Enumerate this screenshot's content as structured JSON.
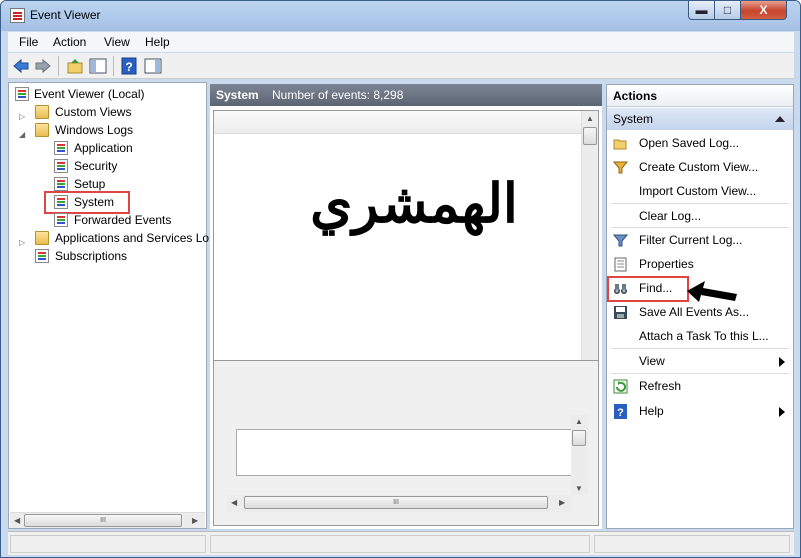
{
  "window": {
    "title": "Event Viewer",
    "icon": "event-viewer-icon"
  },
  "caption_buttons": {
    "minimize": "▬",
    "maximize": "□",
    "close": "X"
  },
  "menubar": [
    "File",
    "Action",
    "View",
    "Help"
  ],
  "toolbar": [
    "back-arrow-icon",
    "forward-arrow-icon",
    "up-folder-icon",
    "show-hide-tree-icon",
    "help-icon",
    "show-hide-action-pane-icon"
  ],
  "tree": {
    "root": "Event Viewer (Local)",
    "items": [
      {
        "label": "Custom Views",
        "icon": "folder-icon"
      },
      {
        "label": "Windows Logs",
        "icon": "folder-icon"
      },
      {
        "label": "Application",
        "icon": "log-icon"
      },
      {
        "label": "Security",
        "icon": "log-icon"
      },
      {
        "label": "Setup",
        "icon": "log-icon"
      },
      {
        "label": "System",
        "icon": "log-icon"
      },
      {
        "label": "Forwarded Events",
        "icon": "log-icon"
      },
      {
        "label": "Applications and Services Lo",
        "icon": "folder-icon"
      },
      {
        "label": "Subscriptions",
        "icon": "subscription-icon"
      }
    ],
    "selected": "System"
  },
  "center": {
    "log_name": "System",
    "event_count": "Number of events: 8,298",
    "overlay_text": "الهمشري",
    "scroll_grip": "III"
  },
  "actions": {
    "header": "Actions",
    "section": "System",
    "items": [
      {
        "label": "Open Saved Log...",
        "icon": "open-folder-icon"
      },
      {
        "label": "Create Custom View...",
        "icon": "filter-icon"
      },
      {
        "label": "Import Custom View...",
        "icon": ""
      },
      {
        "label": "Clear Log...",
        "icon": ""
      },
      {
        "label": "Filter Current Log...",
        "icon": "filter-icon"
      },
      {
        "label": "Properties",
        "icon": "properties-icon"
      },
      {
        "label": "Find...",
        "icon": "binoculars-icon"
      },
      {
        "label": "Save All Events As...",
        "icon": "save-icon"
      },
      {
        "label": "Attach a Task To this L...",
        "icon": ""
      },
      {
        "label": "View",
        "icon": ""
      },
      {
        "label": "Refresh",
        "icon": "refresh-icon"
      },
      {
        "label": "Help",
        "icon": "help-icon"
      }
    ]
  },
  "colors": {
    "highlight_box": "#e04545",
    "header_bg": "#5c6574",
    "action_section_bg": "#c3d4ec"
  }
}
